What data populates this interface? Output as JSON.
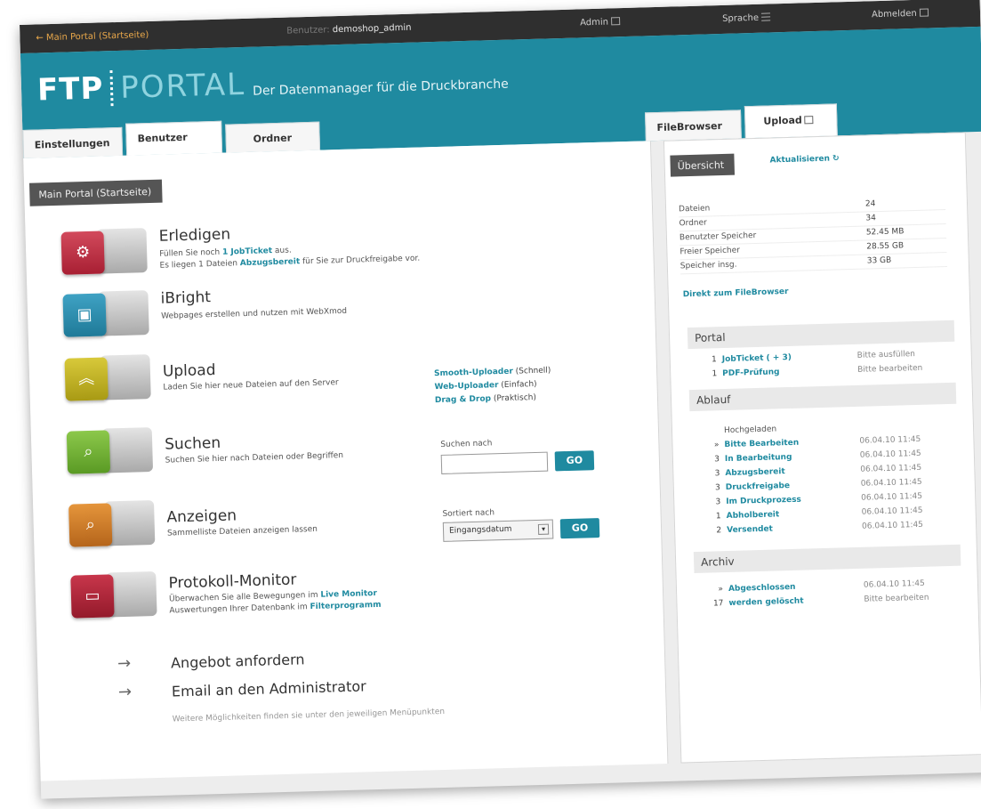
{
  "topbar": {
    "home_link": "← Main Portal (Startseite)",
    "user_label": "Benutzer:",
    "user_name": "demoshop_admin",
    "admin": "Admin",
    "language": "Sprache",
    "logout": "Abmelden"
  },
  "header": {
    "logo_left": "FTP",
    "logo_right": "PORTAL",
    "tagline": "Der Datenmanager für die Druckbranche",
    "tabs": [
      "Einstellungen",
      "Benutzer",
      "Ordner"
    ],
    "right_tabs": [
      "FileBrowser",
      "Upload"
    ]
  },
  "main": {
    "section_title": "Main Portal (Startseite)",
    "entries": {
      "erledigen": {
        "title": "Erledigen",
        "line1_pre": "Füllen Sie noch ",
        "line1_link": "1 JobTicket",
        "line1_post": " aus.",
        "line2_pre": "Es liegen 1 Dateien ",
        "line2_link": "Abzugsbereit",
        "line2_post": " für Sie zur Druckfreigabe vor."
      },
      "ibright": {
        "title": "iBright",
        "desc": "Webpages erstellen und nutzen mit WebXmod"
      },
      "upload": {
        "title": "Upload",
        "desc": "Laden Sie hier neue Dateien auf den Server",
        "link1": "Smooth-Uploader",
        "link1_sub": "(Schnell)",
        "link2": "Web-Uploader",
        "link2_sub": "(Einfach)",
        "link3": "Drag & Drop",
        "link3_sub": "(Praktisch)"
      },
      "suchen": {
        "title": "Suchen",
        "desc": "Suchen Sie hier nach Dateien oder Begriffen",
        "search_label": "Suchen nach",
        "search_value": "",
        "go": "GO"
      },
      "anzeigen": {
        "title": "Anzeigen",
        "desc": "Sammelliste Dateien anzeigen lassen",
        "sort_label": "Sortiert nach",
        "sort_value": "Eingangsdatum",
        "go": "GO"
      },
      "protokoll": {
        "title": "Protokoll-Monitor",
        "line1_pre": "Überwachen Sie alle Bewegungen im ",
        "line1_link": "Live Monitor",
        "line2_pre": "Auswertungen Ihrer Datenbank im ",
        "line2_link": "Filterprogramm"
      }
    },
    "arrow_links": [
      "Angebot anfordern",
      "Email an den Administrator"
    ],
    "hint": "Weitere Möglichkeiten finden sie unter den jeweiligen Menüpunkten"
  },
  "side": {
    "tab_dark": "Übersicht",
    "refresh": "Aktualisieren",
    "stats": [
      {
        "k": "Dateien",
        "v": "24"
      },
      {
        "k": "Ordner",
        "v": "34"
      },
      {
        "k": "Benutzter Speicher",
        "v": "52.45 MB"
      },
      {
        "k": "Freier Speicher",
        "v": "28.55 GB"
      },
      {
        "k": "Speicher insg.",
        "v": "33 GB"
      }
    ],
    "direct_link": "Direkt zum FileBrowser",
    "portal": {
      "head": "Portal",
      "items": [
        {
          "n": "1",
          "t": "JobTicket ( + 3)",
          "d": "Bitte ausfüllen"
        },
        {
          "n": "1",
          "t": "PDF-Prüfung",
          "d": "Bitte bearbeiten"
        }
      ]
    },
    "ablauf": {
      "head": "Ablauf",
      "subhead": "Hochgeladen",
      "items": [
        {
          "n": "»",
          "t": "Bitte Bearbeiten",
          "d": "06.04.10 11:45"
        },
        {
          "n": "3",
          "t": "In Bearbeitung",
          "d": "06.04.10 11:45"
        },
        {
          "n": "3",
          "t": "Abzugsbereit",
          "d": "06.04.10 11:45"
        },
        {
          "n": "3",
          "t": "Druckfreigabe",
          "d": "06.04.10 11:45"
        },
        {
          "n": "3",
          "t": "Im Druckprozess",
          "d": "06.04.10 11:45"
        },
        {
          "n": "1",
          "t": "Abholbereit",
          "d": "06.04.10 11:45"
        },
        {
          "n": "2",
          "t": "Versendet",
          "d": "06.04.10 11:45"
        }
      ]
    },
    "archiv": {
      "head": "Archiv",
      "items": [
        {
          "n": "»",
          "t": "Abgeschlossen",
          "d": "06.04.10 11:45"
        },
        {
          "n": "17",
          "t": "werden gelöscht",
          "d": "Bitte bearbeiten"
        }
      ]
    }
  }
}
